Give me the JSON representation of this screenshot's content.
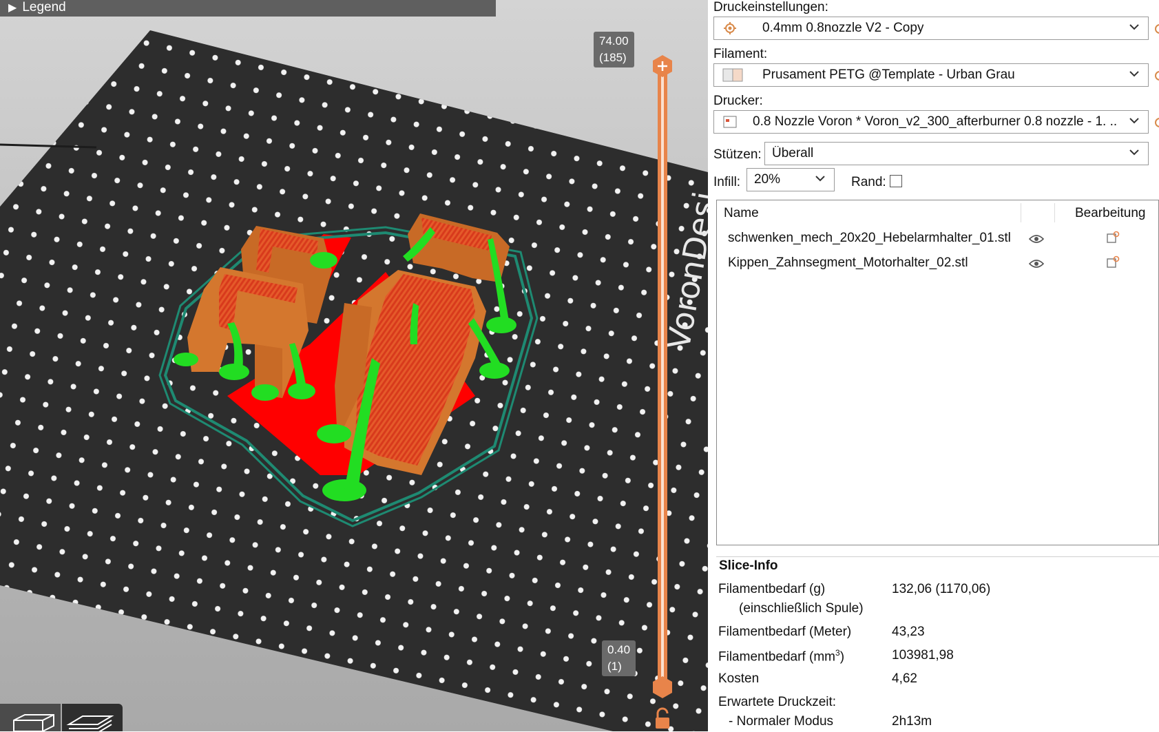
{
  "viewport": {
    "legend_label": "Legend",
    "slider_top_value": "74.00",
    "slider_top_layer": "(185)",
    "slider_bottom_value": "0.40",
    "slider_bottom_layer": "(1)",
    "bed_logo_text": "VoronDesi"
  },
  "panel": {
    "print_settings_label": "Druckeinstellungen:",
    "print_settings_value": "0.4mm 0.8nozzle V2 - Copy",
    "filament_label": "Filament:",
    "filament_value": "Prusament PETG @Template - Urban Grau",
    "printer_label": "Drucker:",
    "printer_value": "0.8 Nozzle Voron  * Voron_v2_300_afterburner 0.8 nozzle - 1. ...",
    "supports_label": "Stützen:",
    "supports_value": "Überall",
    "infill_label": "Infill:",
    "infill_value": "20%",
    "brim_label": "Rand:",
    "brim_checked": false
  },
  "object_list": {
    "col_name": "Name",
    "col_edit": "Bearbeitung",
    "items": [
      {
        "name": "schwenken_mech_20x20_Hebelarmhalter_01.stl"
      },
      {
        "name": "Kippen_Zahnsegment_Motorhalter_02.stl"
      }
    ]
  },
  "slice_info": {
    "title": "Slice-Info",
    "filament_g_label": "Filamentbedarf (g)",
    "filament_g_sublabel": "(einschließlich Spule)",
    "filament_g_value": "132,06 (1170,06)",
    "filament_m_label": "Filamentbedarf (Meter)",
    "filament_m_value": "43,23",
    "filament_mm3_label": "Filamentbedarf (mm",
    "filament_mm3_sup": "3",
    "filament_mm3_label_end": ")",
    "filament_mm3_value": "103981,98",
    "cost_label": "Kosten",
    "cost_value": "4,62",
    "print_time_label": "Erwartete Druckzeit:",
    "normal_mode_label": "- Normaler Modus",
    "normal_mode_value": "2h13m"
  },
  "colors": {
    "slider": "#e8844a",
    "perimeter": "#e07a2c",
    "support": "#22dd22",
    "skirt": "#1e8a72",
    "infill": "#ff0000",
    "bed": "#2d2d2d"
  }
}
